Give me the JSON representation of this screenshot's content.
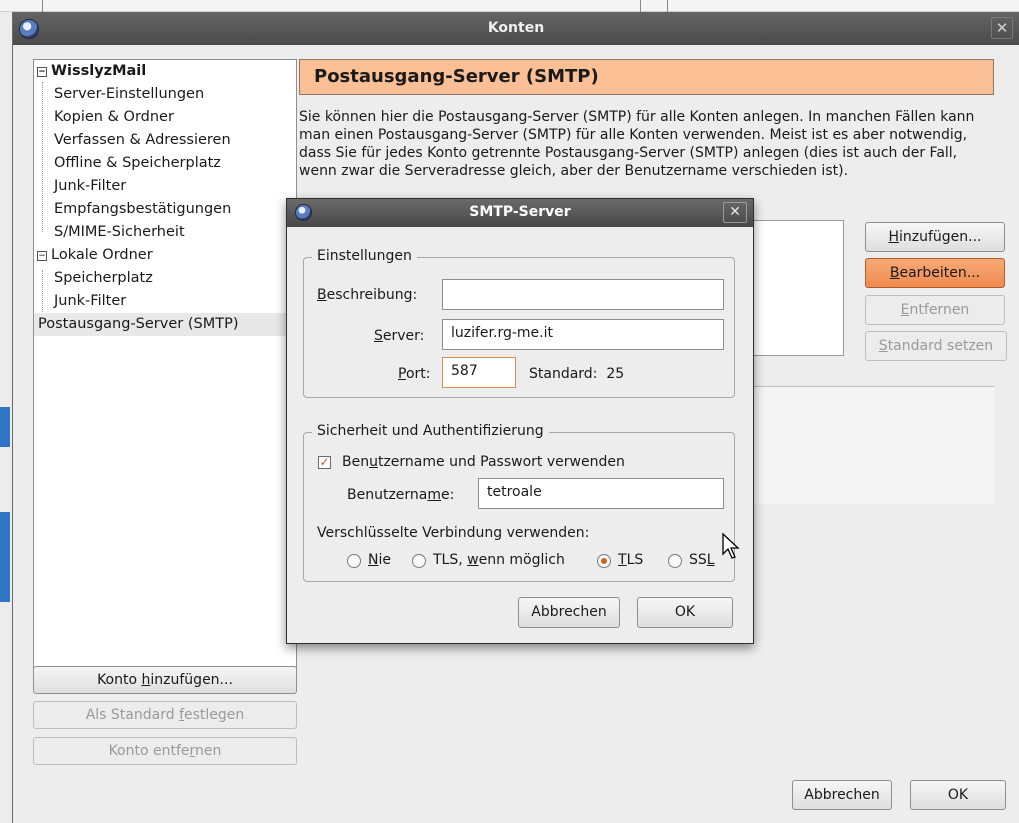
{
  "window": {
    "title": "Konten",
    "close_glyph": "✕"
  },
  "tree": {
    "items": [
      {
        "label": "WisslyzMail",
        "expander": "−"
      },
      {
        "label": "Server-Einstellungen"
      },
      {
        "label": "Kopien & Ordner"
      },
      {
        "label": "Verfassen & Adressieren"
      },
      {
        "label": "Offline & Speicherplatz"
      },
      {
        "label": "Junk-Filter"
      },
      {
        "label": "Empfangsbestätigungen"
      },
      {
        "label": "S/MIME-Sicherheit"
      },
      {
        "label": "Lokale Ordner",
        "expander": "−"
      },
      {
        "label": "Speicherplatz"
      },
      {
        "label": "Junk-Filter"
      },
      {
        "label": "Postausgang-Server (SMTP)"
      }
    ]
  },
  "left_buttons": {
    "add_account": {
      "pre": "Konto ",
      "key": "h",
      "post": "inzufügen..."
    },
    "set_default": {
      "pre": "Als Standard ",
      "key": "f",
      "post": "estlegen"
    },
    "remove_account": {
      "pre": "Konto entfe",
      "key": "r",
      "post": "nen"
    }
  },
  "panel": {
    "header": "Postausgang-Server (SMTP)",
    "description": "Sie können hier die Postausgang-Server (SMTP) für alle Konten anlegen. In manchen Fällen kann man einen Postausgang-Server (SMTP) für alle Konten verwenden. Meist ist es aber notwendig, dass Sie für jedes Konto getrennte Postausgang-Server (SMTP) anlegen (dies ist auch der Fall, wenn zwar die Serveradresse gleich, aber der Benutzername verschieden ist).",
    "buttons": {
      "add": {
        "key": "H",
        "post": "inzufügen..."
      },
      "edit": {
        "key": "B",
        "post": "earbeiten..."
      },
      "remove": {
        "key": "E",
        "post": "ntfernen"
      },
      "set_default": {
        "key": "S",
        "post": "tandard setzen"
      }
    }
  },
  "footer": {
    "cancel": "Abbrechen",
    "ok": "OK"
  },
  "dialog": {
    "title": "SMTP-Server",
    "close_glyph": "✕",
    "settings_legend": "Einstellungen",
    "description_label": {
      "key": "B",
      "post": "eschreibung:"
    },
    "description_value": "",
    "server_label": {
      "key": "S",
      "post": "erver:"
    },
    "server_value": "luzifer.rg-me.it",
    "port_label": {
      "key": "P",
      "post": "ort:"
    },
    "port_value": "587",
    "default_text": "Standard:",
    "default_port": "25",
    "security_legend": "Sicherheit und Authentifizierung",
    "use_auth": {
      "pre": "Ben",
      "key": "u",
      "post": "tzername und Passwort verwenden",
      "checked": true,
      "check_glyph": "✓"
    },
    "username_label": {
      "pre": "Benutzerna",
      "key": "m",
      "post": "e:"
    },
    "username_value": "tetroale",
    "encryption_label": "Verschlüsselte Verbindung verwenden:",
    "encryption_options": [
      {
        "pre": "",
        "key": "N",
        "post": "ie",
        "selected": false
      },
      {
        "pre": "TLS, ",
        "key": "w",
        "post": "enn möglich",
        "selected": false
      },
      {
        "pre": "",
        "key": "T",
        "post": "LS",
        "selected": true
      },
      {
        "pre": "SS",
        "key": "L",
        "post": "",
        "selected": false
      }
    ],
    "cancel": "Abbrechen",
    "ok": "OK"
  },
  "colors": {
    "accent": "#fbbf95",
    "hover_button": "#f29a62",
    "titlebar": "#555555"
  }
}
